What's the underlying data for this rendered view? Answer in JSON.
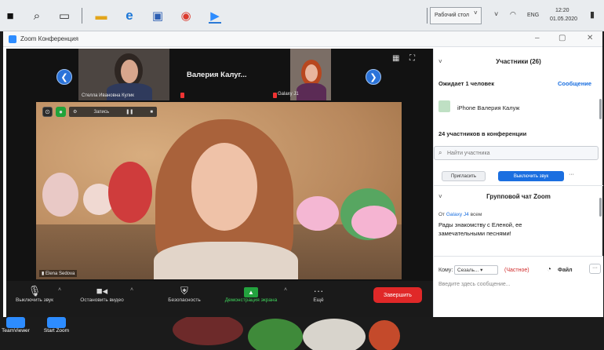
{
  "taskbar": {
    "apps": [
      {
        "name": "windows-start-icon",
        "glyph": "■"
      },
      {
        "name": "search-icon",
        "glyph": "⌕"
      },
      {
        "name": "task-view-icon",
        "glyph": "▭"
      },
      {
        "name": "file-explorer-icon",
        "glyph": "▬"
      },
      {
        "name": "edge-icon",
        "glyph": "e"
      },
      {
        "name": "photos-icon",
        "glyph": "▣"
      },
      {
        "name": "chrome-icon",
        "glyph": "◉"
      },
      {
        "name": "zoom-taskbar-icon",
        "glyph": "▶"
      }
    ],
    "desktop_label": "Рабочий стол",
    "language": "ENG",
    "time": "12:20",
    "date": "01.05.2020"
  },
  "window": {
    "title": "Zoom Конференция"
  },
  "video": {
    "thumbnails": [
      {
        "name": "Стелла Ивановна Кулик"
      },
      {
        "name": "Galaxy J1"
      }
    ],
    "center_name": "Валерия Калуг...",
    "main_label": "Elena Sedova",
    "overlay_text": "Запись",
    "toolbar": {
      "mute": "Выключить звук",
      "video": "Остановить видео",
      "security": "Безопасность",
      "share": "Демонстрация экрана",
      "more": "Ещё",
      "end": "Завершить"
    }
  },
  "panel": {
    "participants_title": "Участники (26)",
    "waiting": "Ожидает 1 человек",
    "message_all": "Сообщение",
    "waiting_device": "iPhone Валерия Калуж",
    "in_conference": "24 участников в конференции",
    "search_placeholder": "Найти участника",
    "btn_invite": "Пригласить",
    "btn_mute_all": "Выключить звук",
    "chat_title": "Групповой чат Zoom",
    "chat_from": "От",
    "chat_sender": "Galaxy J4",
    "chat_to_label": "всем",
    "chat_message": "Рады знакомству с Еленой, ее замечательными песнями!",
    "to_label": "Кому:",
    "to_value": "Сезаль...",
    "private_label": "(Частное)",
    "file_label": "Файл",
    "more_label": "···",
    "input_placeholder": "Введите здесь сообщение..."
  },
  "desktop": {
    "icons": [
      {
        "label": "TeamViewer"
      },
      {
        "label": "Start Zoom"
      }
    ]
  }
}
